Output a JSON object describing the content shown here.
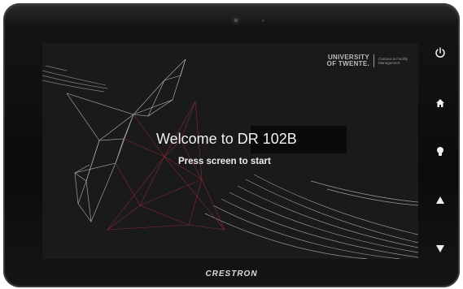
{
  "screen": {
    "logo": {
      "line1": "UNIVERSITY",
      "line2": "OF TWENTE.",
      "dept_line1": "Campus & Facility",
      "dept_line2": "Management"
    },
    "welcome": "Welcome to DR 102B",
    "prompt": "Press screen to start"
  },
  "side_buttons": [
    {
      "name": "power",
      "icon": "power-icon"
    },
    {
      "name": "home",
      "icon": "home-icon"
    },
    {
      "name": "light",
      "icon": "lightbulb-icon"
    },
    {
      "name": "volume-up",
      "icon": "up-arrow-icon"
    },
    {
      "name": "volume-down",
      "icon": "down-arrow-icon"
    }
  ],
  "bezel": {
    "brand": "CRESTRON"
  },
  "colors": {
    "bezel": "#0b0b0b",
    "screen": "#1a1a1a",
    "accent_red": "#8a2a38",
    "text": "#f2f2f2"
  }
}
